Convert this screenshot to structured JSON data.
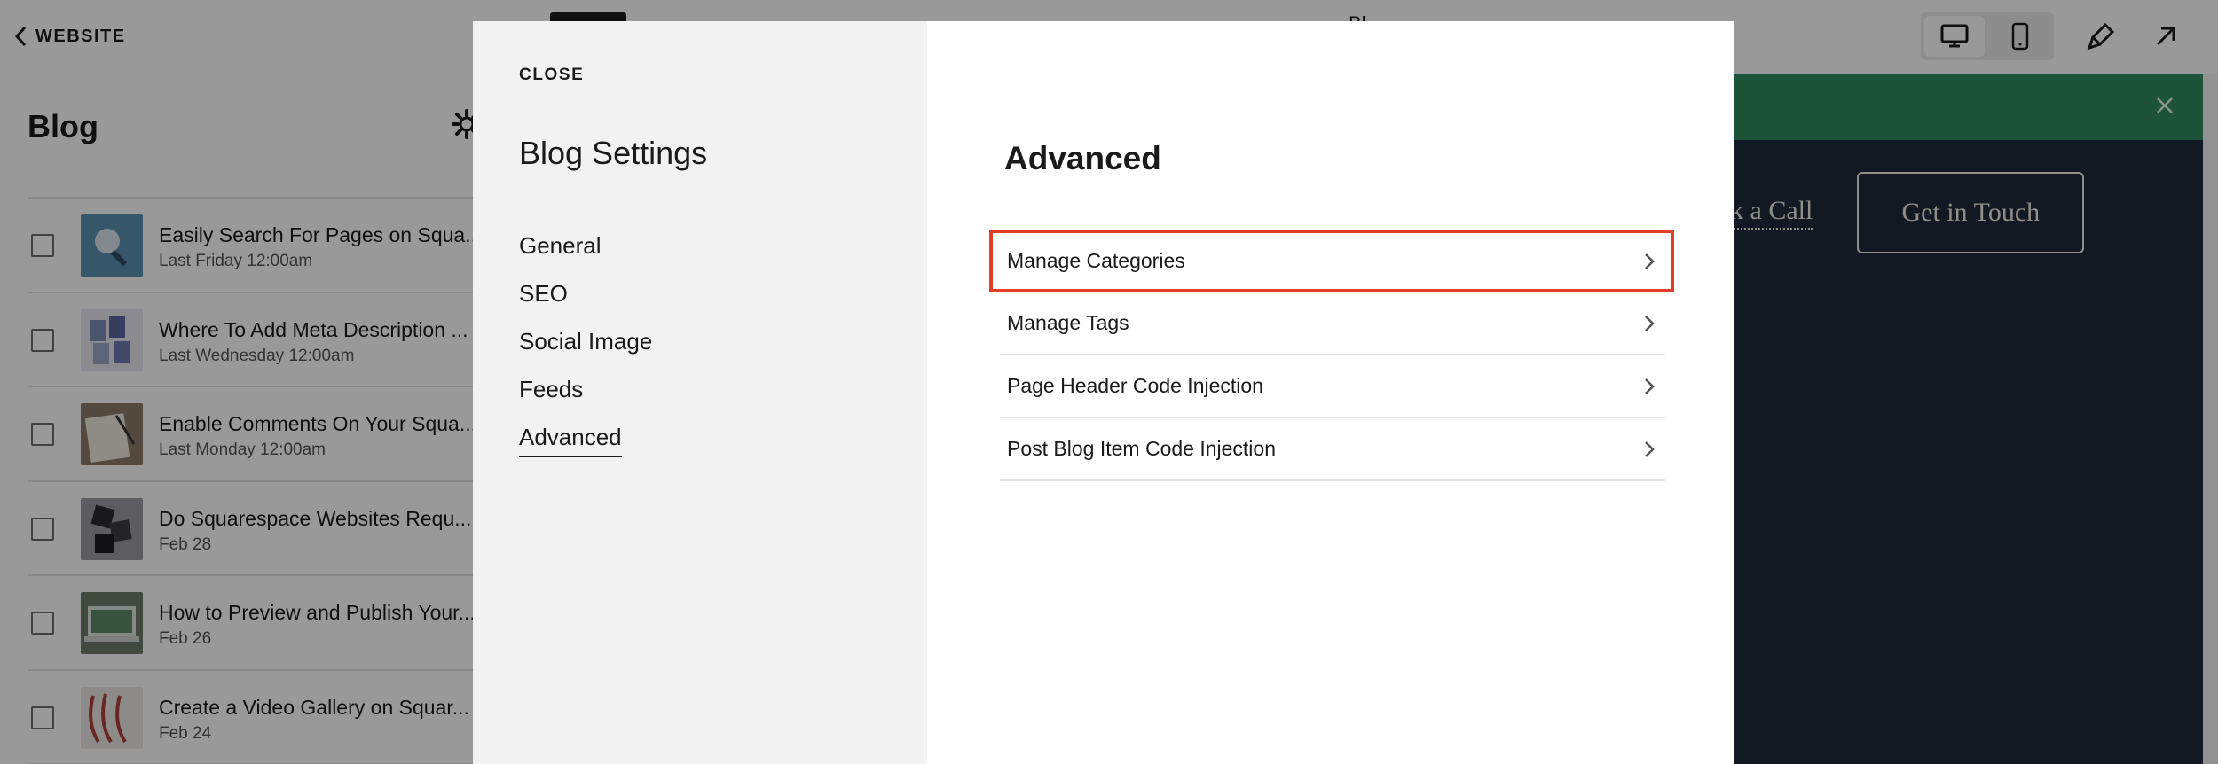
{
  "left_panel": {
    "back_label": "WEBSITE",
    "title": "Blog",
    "posts": [
      {
        "title": "Easily Search For Pages on Squa...",
        "date": "Last Friday 12:00am",
        "thumb_color": "#5a8fb0"
      },
      {
        "title": "Where To Add Meta Description ...",
        "date": "Last Wednesday 12:00am",
        "thumb_color": "#7c8fb8"
      },
      {
        "title": "Enable Comments On Your Squa...",
        "date": "Last Monday 12:00am",
        "thumb_color": "#8a7a68"
      },
      {
        "title": "Do Squarespace Websites Requ...",
        "date": "Feb 28",
        "thumb_color": "#3c3c44"
      },
      {
        "title": "How to Preview and Publish Your...",
        "date": "Feb 26",
        "thumb_color": "#6f7c6a"
      },
      {
        "title": "Create a Video Gallery on Squar...",
        "date": "Feb 24",
        "thumb_color": "#b0413a"
      }
    ]
  },
  "site_preview": {
    "page_title": "Bl",
    "book_call_label": "ok a Call",
    "get_in_touch_label": "Get in Touch"
  },
  "modal": {
    "close_label": "CLOSE",
    "title": "Blog Settings",
    "nav": {
      "general": "General",
      "seo": "SEO",
      "social": "Social Image",
      "feeds": "Feeds",
      "advanced": "Advanced"
    },
    "section_title": "Advanced",
    "options": {
      "manage_categories": "Manage Categories",
      "manage_tags": "Manage Tags",
      "page_header_code": "Page Header Code Injection",
      "post_blog_item_code": "Post Blog Item Code Injection"
    }
  },
  "colors": {
    "highlight": "#e23d28",
    "announcement": "#2f8a5f",
    "site_bg": "#1e2a3a"
  }
}
